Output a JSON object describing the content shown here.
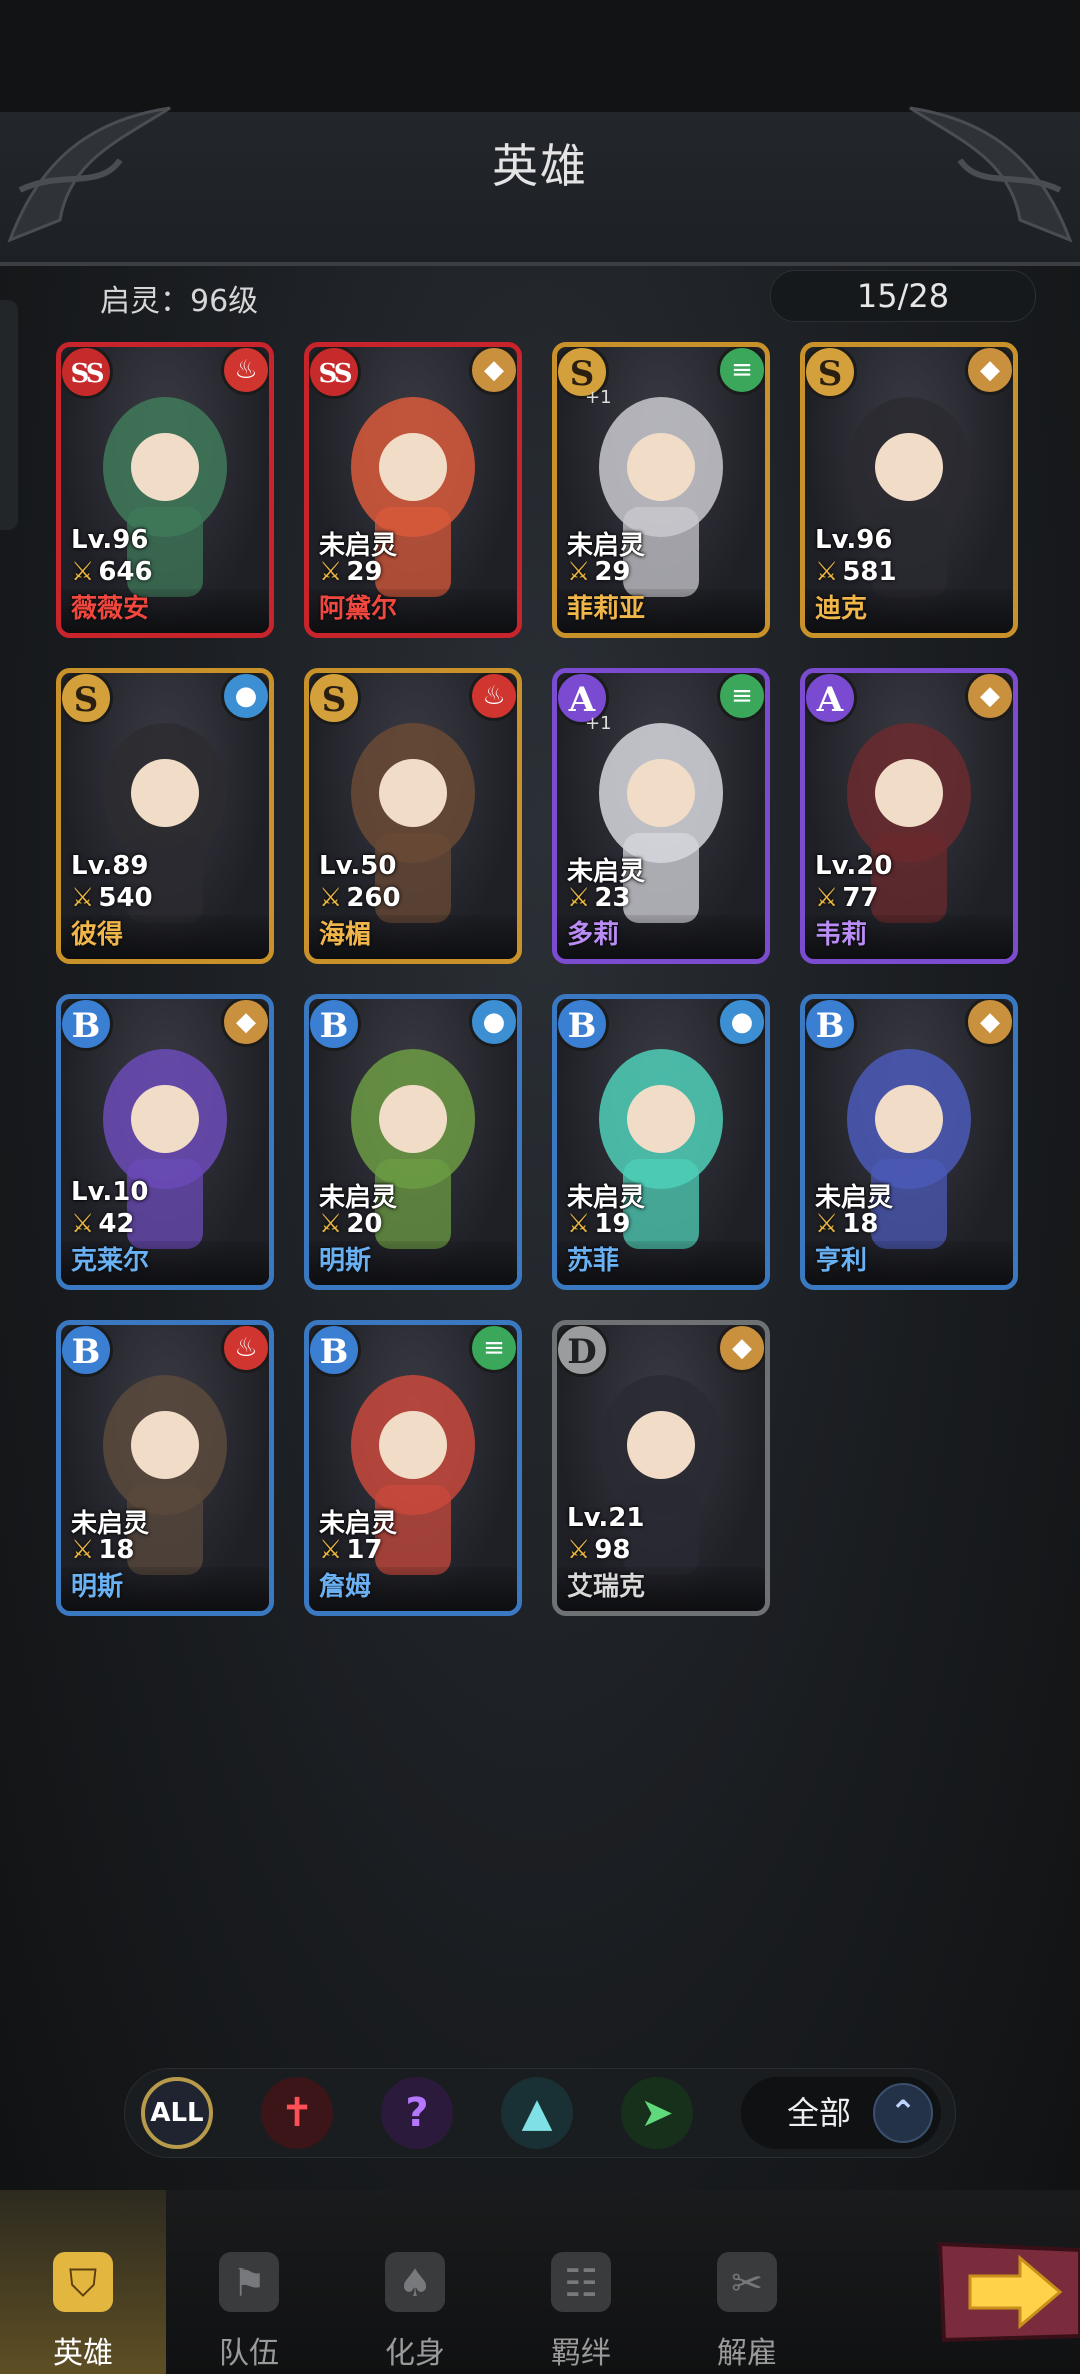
{
  "header": {
    "title": "英雄"
  },
  "status": {
    "spirit_level": "启灵：96级",
    "hero_count": "15/28"
  },
  "heroes": [
    {
      "rank": "SS",
      "element": "fire",
      "level": "Lv.96",
      "power": "646",
      "name": "薇薇安",
      "frame": "red",
      "plus": ""
    },
    {
      "rank": "SS",
      "element": "earth",
      "level": "未启灵",
      "power": "29",
      "name": "阿黛尔",
      "frame": "red",
      "plus": ""
    },
    {
      "rank": "S",
      "element": "wind",
      "level": "未启灵",
      "power": "29",
      "name": "菲莉亚",
      "frame": "gold",
      "plus": "+1"
    },
    {
      "rank": "S",
      "element": "earth",
      "level": "Lv.96",
      "power": "581",
      "name": "迪克",
      "frame": "gold",
      "plus": ""
    },
    {
      "rank": "S",
      "element": "water",
      "level": "Lv.89",
      "power": "540",
      "name": "彼得",
      "frame": "gold",
      "plus": ""
    },
    {
      "rank": "S",
      "element": "fire",
      "level": "Lv.50",
      "power": "260",
      "name": "海楣",
      "frame": "gold",
      "plus": ""
    },
    {
      "rank": "A",
      "element": "wind",
      "level": "未启灵",
      "power": "23",
      "name": "多莉",
      "frame": "purple",
      "plus": "+1"
    },
    {
      "rank": "A",
      "element": "earth",
      "level": "Lv.20",
      "power": "77",
      "name": "韦莉",
      "frame": "purple",
      "plus": ""
    },
    {
      "rank": "B",
      "element": "earth",
      "level": "Lv.10",
      "power": "42",
      "name": "克莱尔",
      "frame": "blue",
      "plus": ""
    },
    {
      "rank": "B",
      "element": "water",
      "level": "未启灵",
      "power": "20",
      "name": "明斯",
      "frame": "blue",
      "plus": ""
    },
    {
      "rank": "B",
      "element": "water",
      "level": "未启灵",
      "power": "19",
      "name": "苏菲",
      "frame": "blue",
      "plus": ""
    },
    {
      "rank": "B",
      "element": "earth",
      "level": "未启灵",
      "power": "18",
      "name": "亨利",
      "frame": "blue",
      "plus": ""
    },
    {
      "rank": "B",
      "element": "fire",
      "level": "未启灵",
      "power": "18",
      "name": "明斯",
      "frame": "blue",
      "plus": ""
    },
    {
      "rank": "B",
      "element": "wind",
      "level": "未启灵",
      "power": "17",
      "name": "詹姆",
      "frame": "blue",
      "plus": ""
    },
    {
      "rank": "D",
      "element": "earth",
      "level": "Lv.21",
      "power": "98",
      "name": "艾瑞克",
      "frame": "grey",
      "plus": ""
    }
  ],
  "filters": {
    "all_label": "ALL",
    "class_icons": [
      "warrior-sword-icon",
      "mystic-question-icon",
      "healer-crown-icon",
      "archer-bow-icon"
    ],
    "sort_label": "全部",
    "sort_toggle_icon": "double-chevron-up-icon"
  },
  "nav": [
    {
      "label": "英雄",
      "icon": "helmet-icon",
      "active": true
    },
    {
      "label": "队伍",
      "icon": "flag-icon",
      "active": false
    },
    {
      "label": "化身",
      "icon": "card-icon",
      "active": false
    },
    {
      "label": "羁绊",
      "icon": "scroll-icon",
      "active": false
    },
    {
      "label": "解雇",
      "icon": "dismiss-scroll-icon",
      "active": false
    }
  ],
  "colors": {
    "fire": "#d0352f",
    "earth": "#c9903e",
    "wind": "#3aa75a",
    "water": "#3d8fd4",
    "frame_red": "#c7242b",
    "frame_gold": "#c9912a",
    "frame_purple": "#7b4bd0",
    "frame_blue": "#3a78c2",
    "frame_grey": "#6f7274"
  }
}
